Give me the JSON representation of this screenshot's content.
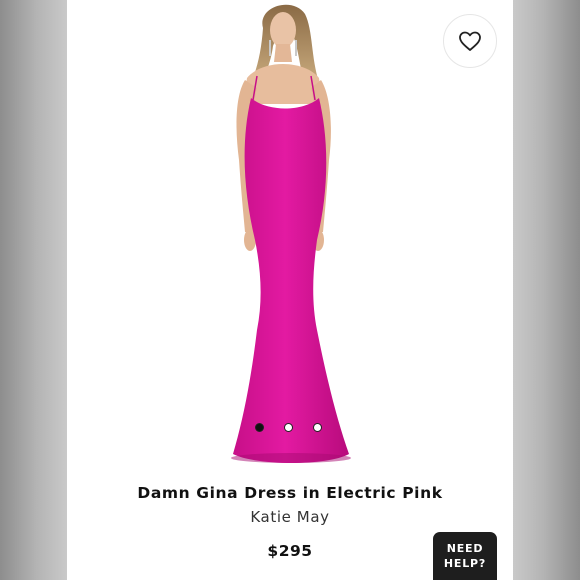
{
  "product": {
    "title": "Damn Gina Dress in Electric Pink",
    "brand": "Katie May",
    "price": "$295",
    "image": {
      "alt": "Model wearing pink mermaid gown",
      "dress_color": "#e0189f"
    }
  },
  "gallery": {
    "dot_count": 3,
    "active_index": 0
  },
  "favorite": {
    "icon": "heart-icon"
  },
  "help_chat": {
    "line1": "NEED",
    "line2": "HELP?"
  },
  "colors": {
    "accent": "#e0189f",
    "help_bg": "#1e1e1e"
  }
}
